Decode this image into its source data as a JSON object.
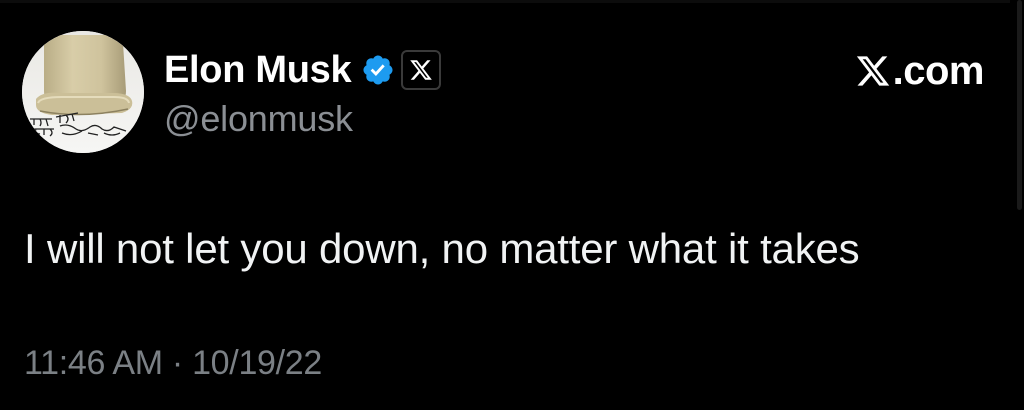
{
  "tweet": {
    "author": {
      "display_name": "Elon Musk",
      "handle": "@elonmusk",
      "verified_icon": "verified-badge-icon",
      "affiliation_icon": "x-logo-icon",
      "avatar_caption": "THE FUTURE IS ARRIVING"
    },
    "brand": {
      "icon": "x-logo-icon",
      "label": ".com"
    },
    "text": "I will not let you down, no matter what it takes",
    "time": "11:46 AM",
    "separator": "·",
    "date": "10/19/22"
  },
  "colors": {
    "background": "#000000",
    "text": "#f1f3f4",
    "secondary_text": "#7b8085",
    "verified_blue": "#1d9bf0"
  }
}
